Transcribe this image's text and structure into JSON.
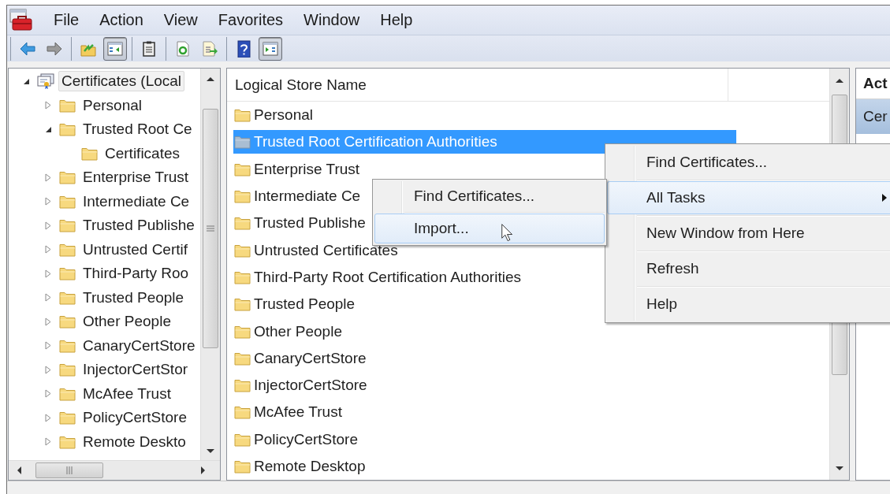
{
  "menu_bar": [
    {
      "label": "File"
    },
    {
      "label": "Action"
    },
    {
      "label": "View"
    },
    {
      "label": "Favorites"
    },
    {
      "label": "Window"
    },
    {
      "label": "Help"
    }
  ],
  "toolbar": [
    {
      "buttons": [
        {
          "kind": "back",
          "pressed": false
        },
        {
          "kind": "forward",
          "pressed": false
        }
      ]
    },
    {
      "buttons": [
        {
          "kind": "up",
          "pressed": false
        },
        {
          "kind": "tree",
          "pressed": true
        }
      ]
    },
    {
      "buttons": [
        {
          "kind": "properties",
          "pressed": false
        }
      ]
    },
    {
      "buttons": [
        {
          "kind": "refresh",
          "pressed": false
        },
        {
          "kind": "export",
          "pressed": false
        }
      ]
    },
    {
      "buttons": [
        {
          "kind": "help",
          "pressed": false
        },
        {
          "kind": "action",
          "pressed": true
        }
      ]
    }
  ],
  "tree": {
    "label": "Certificates (Local",
    "expanded": true,
    "selected": true,
    "children": [
      {
        "label": "Personal",
        "expanded": false,
        "selected": false
      },
      {
        "label": "Trusted Root Ce",
        "expanded": true,
        "selected": false,
        "children": [
          {
            "label": "Certificates",
            "selected": false
          }
        ]
      },
      {
        "label": "Enterprise Trust",
        "expanded": false,
        "selected": false
      },
      {
        "label": "Intermediate Ce",
        "expanded": false,
        "selected": false
      },
      {
        "label": "Trusted Publishe",
        "expanded": false,
        "selected": false
      },
      {
        "label": "Untrusted Certif",
        "expanded": false,
        "selected": false
      },
      {
        "label": "Third-Party Roo",
        "expanded": false,
        "selected": false
      },
      {
        "label": "Trusted People",
        "expanded": false,
        "selected": false
      },
      {
        "label": "Other People",
        "expanded": false,
        "selected": false
      },
      {
        "label": "CanaryCertStore",
        "expanded": false,
        "selected": false
      },
      {
        "label": "InjectorCertStor",
        "expanded": false,
        "selected": false
      },
      {
        "label": "McAfee Trust",
        "expanded": false,
        "selected": false
      },
      {
        "label": "PolicyCertStore",
        "expanded": false,
        "selected": false
      },
      {
        "label": "Remote Deskto",
        "expanded": false,
        "selected": false
      }
    ]
  },
  "list": {
    "columns": [
      "Logical Store Name"
    ],
    "rows": [
      {
        "label": "Personal",
        "selected": false
      },
      {
        "label": "Trusted Root Certification Authorities",
        "selected": true
      },
      {
        "label": "Enterprise Trust",
        "selected": false
      },
      {
        "label": "Intermediate Ce",
        "selected": false
      },
      {
        "label": "Trusted Publishe",
        "selected": false
      },
      {
        "label": "Untrusted Certificates",
        "selected": false
      },
      {
        "label": "Third-Party Root Certification Authorities",
        "selected": false
      },
      {
        "label": "Trusted People",
        "selected": false
      },
      {
        "label": "Other People",
        "selected": false
      },
      {
        "label": "CanaryCertStore",
        "selected": false
      },
      {
        "label": "InjectorCertStore",
        "selected": false
      },
      {
        "label": "McAfee Trust",
        "selected": false
      },
      {
        "label": "PolicyCertStore",
        "selected": false
      },
      {
        "label": "Remote Desktop",
        "selected": false
      }
    ]
  },
  "actions": {
    "header": "Act",
    "items": [
      {
        "label": "Cer",
        "selected": true
      }
    ]
  },
  "context_menu": {
    "items": [
      {
        "label": "Find Certificates...",
        "selected": false,
        "submenu": false
      },
      {
        "label": "All Tasks",
        "selected": true,
        "submenu": true
      },
      {
        "label": "New Window from Here",
        "selected": false,
        "submenu": false
      },
      {
        "label": "Refresh",
        "selected": false,
        "submenu": false
      },
      {
        "label": "Help",
        "selected": false,
        "submenu": false
      }
    ]
  },
  "submenu": {
    "items": [
      {
        "label": "Find Certificates...",
        "selected": false,
        "submenu": false
      },
      {
        "label": "Import...",
        "selected": true,
        "submenu": false
      }
    ]
  }
}
